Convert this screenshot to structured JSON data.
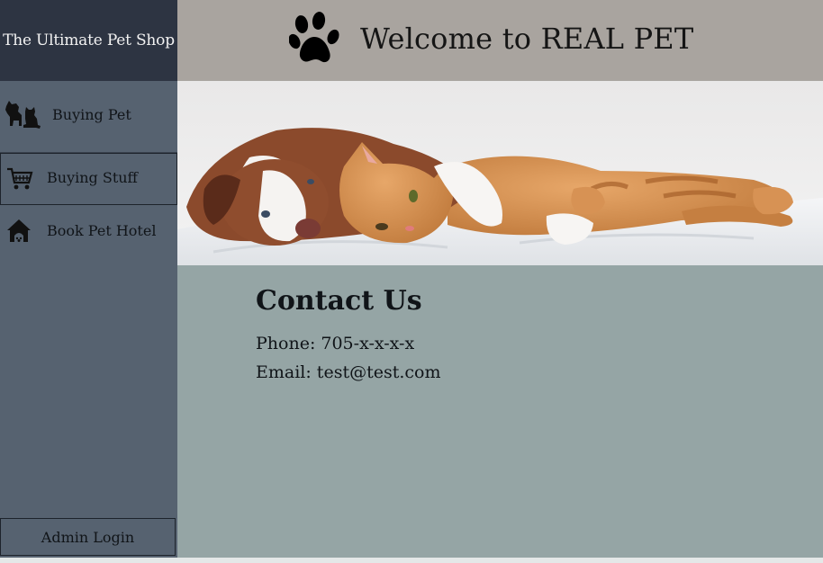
{
  "sidebar": {
    "brand": "The Ultimate Pet Shop",
    "items": [
      {
        "label": "Buying Pet",
        "icon": "pets-icon"
      },
      {
        "label": "Buying Stuff",
        "icon": "cart-icon"
      },
      {
        "label": "Book Pet Hotel",
        "icon": "pet-house-icon"
      }
    ],
    "admin_label": "Admin Login"
  },
  "header": {
    "icon": "paw-icon",
    "title": "Welcome to REAL PET"
  },
  "banner": {
    "subject": "dog-and-cat-photo"
  },
  "contact": {
    "title": "Contact Us",
    "phone": "Phone: 705-x-x-x-x",
    "email": "Email: test@test.com"
  },
  "colors": {
    "sidebar": "#566270",
    "brand_bg": "#2d3442",
    "header_bg": "#a9a49f",
    "content_bg": "#95a5a5"
  }
}
